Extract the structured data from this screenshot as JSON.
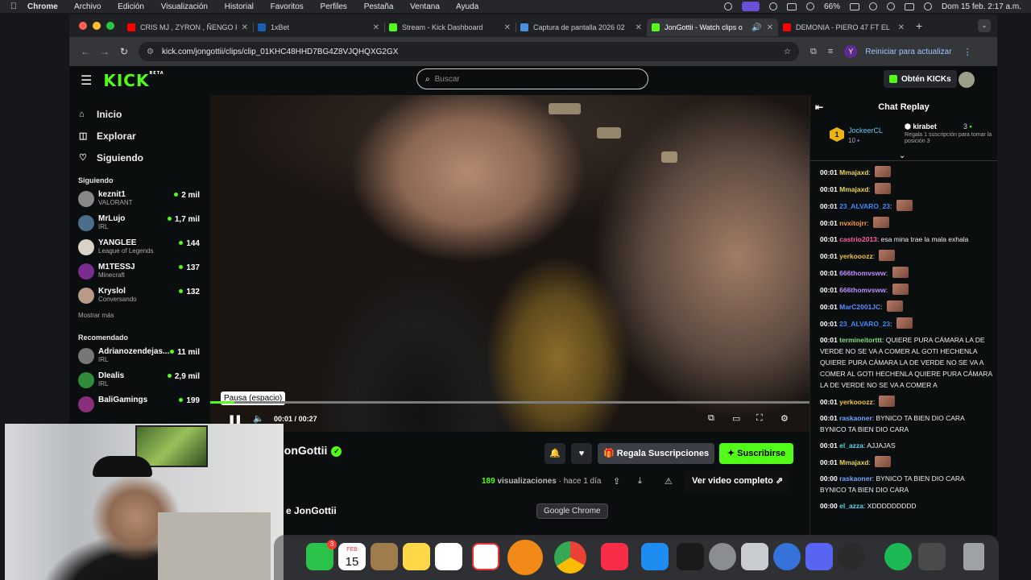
{
  "mac_menubar": {
    "app": "Chrome",
    "items": [
      "Archivo",
      "Edición",
      "Visualización",
      "Historial",
      "Favoritos",
      "Perfiles",
      "Pestaña",
      "Ventana",
      "Ayuda"
    ],
    "battery": "66%",
    "datetime": "Dom 15 feb.  2:17 a.m."
  },
  "browser": {
    "tabs": [
      {
        "title": "CRIS MJ , ZYRON , ÑENGO F",
        "favicon_color": "#ff0000",
        "active": false
      },
      {
        "title": "1xBet",
        "favicon_color": "#1a5fb4",
        "active": false
      },
      {
        "title": "Stream - Kick Dashboard",
        "favicon_color": "#53fc18",
        "active": false
      },
      {
        "title": "Captura de pantalla 2026 02",
        "favicon_color": "#4a90e2",
        "active": false
      },
      {
        "title": "JonGottii - Watch clips o",
        "favicon_color": "#53fc18",
        "active": true
      },
      {
        "title": "DEMONIA - PIERO 47 FT EL",
        "favicon_color": "#ff0000",
        "active": false
      }
    ],
    "url": "kick.com/jongottii/clips/clip_01KHC48HHD7BG4Z8VJQHQXG2GX",
    "profile_initial": "Y",
    "reload_label": "Reiniciar para actualizar"
  },
  "kick": {
    "search_placeholder": "Buscar",
    "kicks_label": "Obtén KICKs",
    "nav": [
      {
        "label": "Inicio",
        "icon": "home-icon"
      },
      {
        "label": "Explorar",
        "icon": "compass-icon"
      },
      {
        "label": "Siguiendo",
        "icon": "heart-icon"
      }
    ],
    "following_title": "Siguiendo",
    "following": [
      {
        "name": "keznit1",
        "category": "VALORANT",
        "viewers": "2 mil",
        "color": "#888"
      },
      {
        "name": "MrLujo",
        "category": "IRL",
        "viewers": "1,7 mil",
        "color": "#4b6f8a"
      },
      {
        "name": "YANGLEE",
        "category": "League of Legends",
        "viewers": "144",
        "color": "#d9d2c6"
      },
      {
        "name": "M1TESSJ",
        "category": "Minecraft",
        "viewers": "137",
        "color": "#7b2c8f"
      },
      {
        "name": "Kryslol",
        "category": "Conversando",
        "viewers": "132",
        "color": "#b89a87"
      }
    ],
    "show_more": "Mostrar más",
    "recommended_title": "Recomendado",
    "recommended": [
      {
        "name": "Adrianozendejas...",
        "category": "IRL",
        "viewers": "11 mil",
        "color": "#777"
      },
      {
        "name": "DIealis",
        "category": "IRL",
        "viewers": "2,9 mil",
        "color": "#2f8a3a"
      },
      {
        "name": "BaliGamings",
        "category": "",
        "viewers": "199",
        "color": "#8a2f7a"
      }
    ]
  },
  "player": {
    "tooltip": "Pausa (espacio)",
    "current_time": "00:01",
    "separator": "/",
    "duration": "00:27",
    "progress_fraction": 0.04
  },
  "clip": {
    "streamer": "JonGottii",
    "gift_label": "Regala Suscripciones",
    "subscribe_label": "Suscribirse",
    "views_count": "189",
    "views_label": "visualizaciones",
    "age": "· hace 1 día",
    "full_video_label": "Ver video completo",
    "byline": "e JonGottii"
  },
  "chat": {
    "title": "Chat Replay",
    "top_gifters": [
      {
        "rank": "1",
        "name": "JockeerCL",
        "count": "10"
      },
      {
        "name": "kirabet",
        "count": "3",
        "desc": "Regala 1 suscripción para tomar la posición 3"
      }
    ],
    "messages": [
      {
        "time": "00:01",
        "user": "Mmajaxd",
        "color": "#e9d34f",
        "text": "",
        "emote": true
      },
      {
        "time": "00:01",
        "user": "Mmajaxd",
        "color": "#e9d34f",
        "text": "",
        "emote": true
      },
      {
        "time": "00:01",
        "user": "23_ALVARO_23",
        "color": "#3c8cff",
        "text": "",
        "emote": true
      },
      {
        "time": "00:01",
        "user": "nvxitojrr",
        "color": "#ff9b3d",
        "text": "",
        "emote": true
      },
      {
        "time": "00:01",
        "user": "castrio2013",
        "color": "#ff5fa2",
        "text": "esa mina trae la mala exhala",
        "emote": false
      },
      {
        "time": "00:01",
        "user": "yerkooozz",
        "color": "#f0c43a",
        "text": "",
        "emote": true
      },
      {
        "time": "00:01",
        "user": "666thomvsww",
        "color": "#c18cff",
        "text": "",
        "emote": true
      },
      {
        "time": "00:01",
        "user": "666thomvsww",
        "color": "#c18cff",
        "text": "",
        "emote": true
      },
      {
        "time": "00:01",
        "user": "MarC2001JC",
        "color": "#5b8cff",
        "text": "",
        "emote": true
      },
      {
        "time": "00:01",
        "user": "23_ALVARO_23",
        "color": "#3c8cff",
        "text": "",
        "emote": true
      },
      {
        "time": "00:01",
        "user": "termineitorttt",
        "color": "#7ee07e",
        "text": "QUIERE PURA CÁMARA LA DE VERDE NO SE VA A COMER AL GOTI HECHENLA QUIERE PURA CÁMARA LA DE VERDE NO SE VA A COMER AL GOTI HECHENLA QUIERE PURA CÁMARA LA DE VERDE NO SE VA A COMER A",
        "emote": false
      },
      {
        "time": "00:01",
        "user": "yerkooozz",
        "color": "#f0c43a",
        "text": "",
        "emote": true
      },
      {
        "time": "00:01",
        "user": "raskaoner",
        "color": "#6fa8ff",
        "text": "BYNICO TA BIEN DIO CARA BYNICO TA BIEN DIO CARA",
        "emote": false
      },
      {
        "time": "00:01",
        "user": "el_azza",
        "color": "#5bd6e8",
        "text": "AJJAJAS",
        "emote": false
      },
      {
        "time": "00:01",
        "user": "Mmajaxd",
        "color": "#e9d34f",
        "text": "",
        "emote": true
      },
      {
        "time": "00:00",
        "user": "raskaoner",
        "color": "#6fa8ff",
        "text": "BYNICO TA BIEN DIO CARA BYNICO TA BIEN DIO CARA",
        "emote": false
      },
      {
        "time": "00:00",
        "user": "el_azza",
        "color": "#5bd6e8",
        "text": "XDDDDDDDDD",
        "emote": false
      }
    ]
  },
  "dock": {
    "tooltip": "Google Chrome",
    "calendar_month": "FEB",
    "calendar_day": "15",
    "messages_badge": "3",
    "apps": [
      "messages",
      "calendar",
      "notes-folder",
      "notes",
      "freeform",
      "mail-app",
      "fl-studio",
      "chrome",
      "music",
      "app-store",
      "capcut",
      "system-settings",
      "mirror",
      "drive",
      "discord",
      "obs",
      "spotify",
      "calculator",
      "trash"
    ]
  }
}
